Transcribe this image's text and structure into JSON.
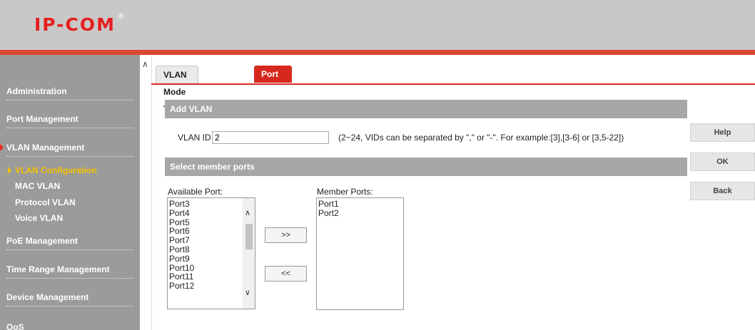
{
  "header": {
    "logo": "IP-COM",
    "registered": "®"
  },
  "sidebar": {
    "items": [
      {
        "label": "Administration"
      },
      {
        "label": "Port Management"
      },
      {
        "label": "VLAN Management"
      },
      {
        "label": "PoE Management"
      },
      {
        "label": "Time Range Management"
      },
      {
        "label": "Device Management"
      },
      {
        "label": "QoS"
      }
    ],
    "subitems": [
      {
        "label": "VLAN Configuration"
      },
      {
        "label": "MAC VLAN"
      },
      {
        "label": "Protocol VLAN"
      },
      {
        "label": "Voice VLAN"
      }
    ]
  },
  "tabs": [
    {
      "label": "VLAN Mode Toggle"
    },
    {
      "label": "Port VLAN"
    }
  ],
  "add_vlan": {
    "title": "Add VLAN",
    "vlan_id_label": "VLAN ID",
    "vlan_id_value": "2",
    "hint": "(2~24, VIDs can be separated by \",\" or \"-\". For example:[3],[3-6] or [3,5-22])"
  },
  "members": {
    "title": "Select member ports",
    "available_label": "Available Port:",
    "member_label": "Member Ports:",
    "available_ports": [
      "Port3",
      "Port4",
      "Port5",
      "Port6",
      "Port7",
      "Port8",
      "Port9",
      "Port10",
      "Port11",
      "Port12"
    ],
    "member_ports": [
      "Port1",
      "Port2"
    ],
    "add_button": ">>",
    "remove_button": "<<"
  },
  "buttons": {
    "help": "Help",
    "ok": "OK",
    "back": "Back"
  }
}
